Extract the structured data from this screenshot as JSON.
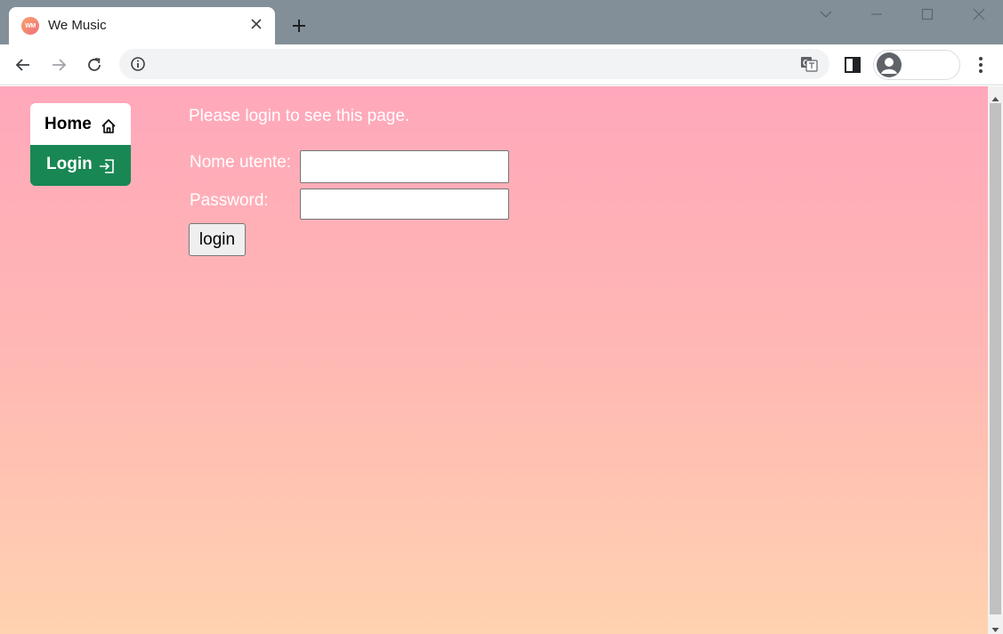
{
  "browser": {
    "tab": {
      "title": "We Music",
      "favicon_text": "WM"
    },
    "omnibox": {
      "url": ""
    }
  },
  "page": {
    "nav": {
      "home_label": "Home",
      "login_label": "Login"
    },
    "message": "Please login to see this page.",
    "form": {
      "username_label": "Nome utente:",
      "username_value": "",
      "password_label": "Password:",
      "password_value": "",
      "submit_label": "login"
    }
  },
  "colors": {
    "titlebar": "#838f98",
    "nav_login_bg": "#198754",
    "page_gradient_top": "#ffa8bb",
    "page_gradient_bottom": "#ffd2b0"
  }
}
